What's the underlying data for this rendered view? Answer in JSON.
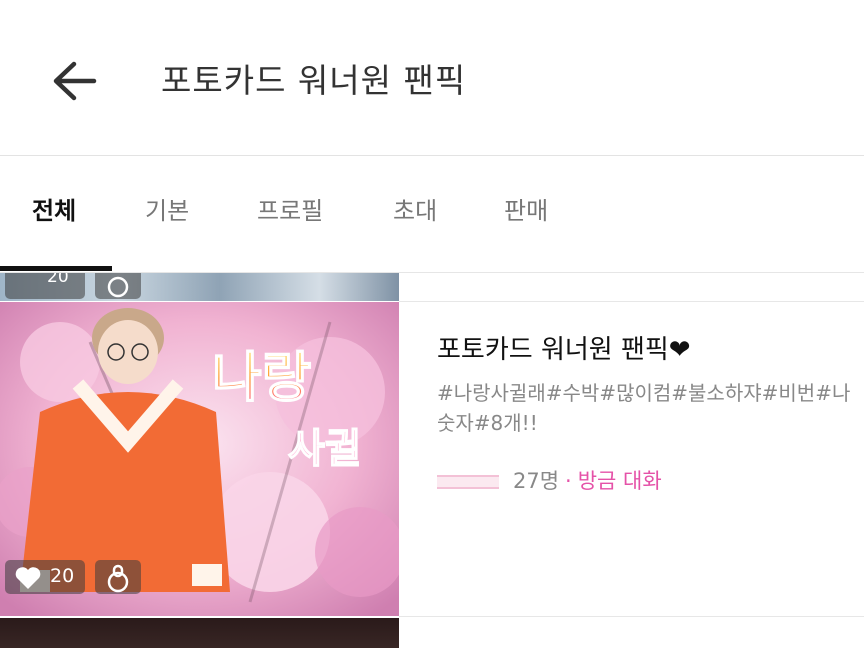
{
  "header": {
    "title": "포토카드 워너원 팬픽"
  },
  "tabs": [
    {
      "label": "전체",
      "active": true
    },
    {
      "label": "기본",
      "active": false
    },
    {
      "label": "프로필",
      "active": false
    },
    {
      "label": "초대",
      "active": false
    },
    {
      "label": "판매",
      "active": false
    }
  ],
  "items": [
    {
      "thumb_overlay": "나랑 사귈",
      "likes": "20",
      "title": "포토카드 워너원 팬픽❤",
      "tags": "#나랑사귈래#수박#많이컴#불소하쟈#비번#나 숫자#8개!!",
      "members": "27명",
      "separator": "·",
      "activity": "방금 대화"
    }
  ],
  "partial_item": {
    "likes": "20"
  },
  "colors": {
    "accent": "#e552a8",
    "text": "#111111",
    "muted": "#888888"
  }
}
